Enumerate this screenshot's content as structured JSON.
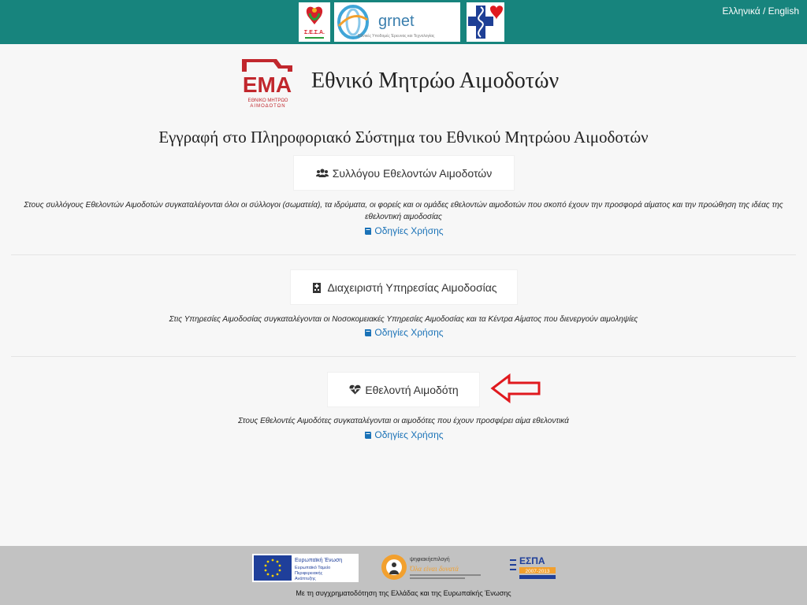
{
  "header": {
    "language_switch": "Ελληνικά / English",
    "logos": {
      "esea_text": "Σ.Ε.Σ.Α.",
      "grnet_text": "grnet",
      "grnet_tagline": "Εθνικές Υποδομές Έρευνας και Τεχνολογίας",
      "ema_letters": "ΕΜΑ",
      "ema_caption1": "ΕΘΝΙΚΟ ΜΗΤΡΩΟ",
      "ema_caption2": "ΑΙΜΟΔΟΤΩΝ"
    },
    "site_title": "Εθνικό Μητρώο Αιμοδοτών",
    "subtitle": "Εγγραφή στο Πληροφοριακό Σύστημα του Εθνικού Μητρώου Αιμοδοτών"
  },
  "sections": [
    {
      "button_label": "Συλλόγου Εθελοντών Αιμοδοτών",
      "icon": "users-icon",
      "description": "Στους συλλόγους Εθελοντών Αιμοδοτών συγκαταλέγονται όλοι οι σύλλογοι (σωματεία), τα ιδρύματα, οι φορείς και οι ομάδες εθελοντών αιμοδοτών που σκοπό έχουν την προσφορά αίματος και την προώθηση της ιδέας της εθελοντική αιμοδοσίας",
      "guide_label": "Οδηγίες Χρήσης"
    },
    {
      "button_label": "Διαχειριστή Υπηρεσίας Αιμοδοσίας",
      "icon": "hospital-icon",
      "description": "Στις Υπηρεσίες Αιμοδοσίας συγκαταλέγονται οι Νοσοκομειακές Υπηρεσίες Αιμοδοσίας και τα Κέντρα Αίματος που διενεργούν αιμοληψίες",
      "guide_label": "Οδηγίες Χρήσης"
    },
    {
      "button_label": "Εθελοντή Αιμοδότη",
      "icon": "heartbeat-icon",
      "description": "Στους Εθελοντές Αιμοδότες συγκαταλέγονται οι αιμοδότες που έχουν προσφέρει αίμα εθελοντικά",
      "guide_label": "Οδηγίες Χρήσης"
    }
  ],
  "footer": {
    "eu_title": "Ευρωπαϊκή Ένωση",
    "eu_sub1": "Ευρωπαϊκό Ταμείο",
    "eu_sub2": "Περιφερειακής",
    "eu_sub3": "Ανάπτυξης",
    "digital_title": "ψηφιακήεπιλογή",
    "digital_slogan": "Όλα είναι δυνατά",
    "espa_title": "ΕΣΠΑ",
    "espa_years": "2007-2013",
    "caption": "Με τη συγχρηματοδότηση της Ελλάδας και της Ευρωπαϊκής Ένωσης"
  },
  "colors": {
    "topbar": "#17847d",
    "link": "#1a72b7",
    "ema_red": "#c1272d",
    "arrow": "#e0191e",
    "footer_bg": "#c2c2c2"
  }
}
